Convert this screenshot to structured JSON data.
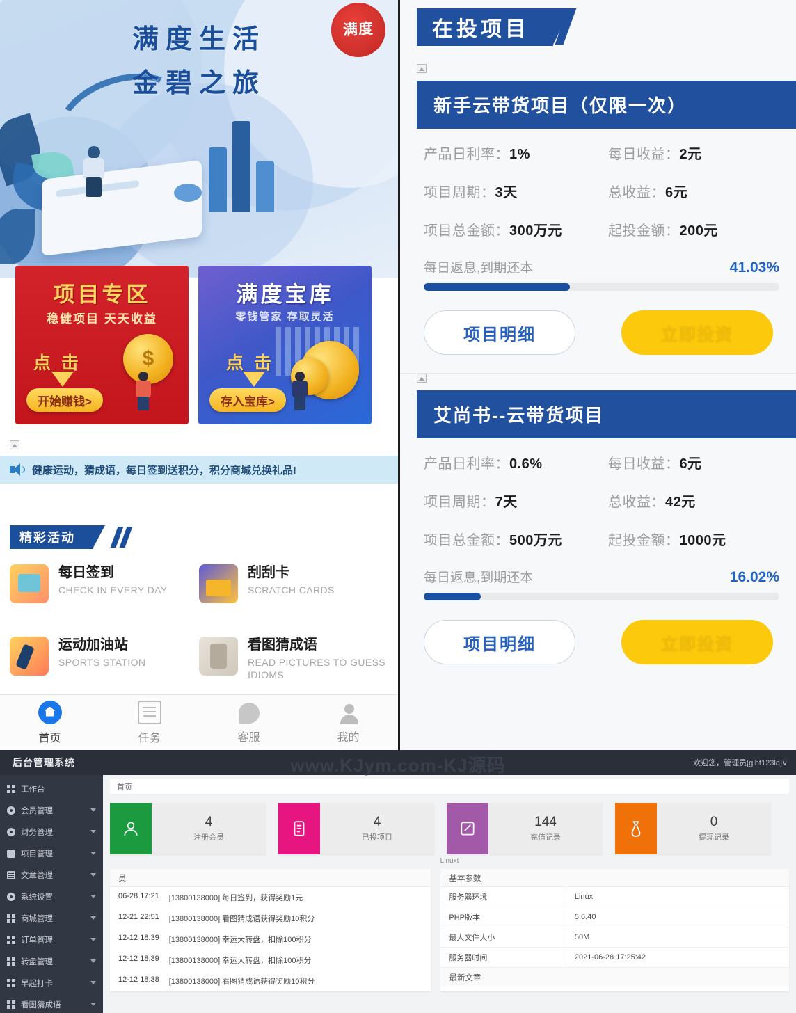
{
  "app_left": {
    "hero": {
      "line1": "满度生活",
      "line2": "金碧之旅",
      "stamp": "满度"
    },
    "promos": [
      {
        "title": "项目专区",
        "subtitle": "稳健项目  天天收益",
        "click": "点 击",
        "button": "开始赚钱>"
      },
      {
        "title": "满度宝库",
        "subtitle": "零钱管家  存取灵活",
        "click": "点 击",
        "button": "存入宝库>"
      }
    ],
    "notice": "健康运动，猜成语，每日签到送积分，积分商城兑换礼品!",
    "section_title": "精彩活动",
    "activities": [
      {
        "cn": "每日签到",
        "en": "CHECK IN EVERY DAY"
      },
      {
        "cn": "刮刮卡",
        "en": "SCRATCH CARDS"
      },
      {
        "cn": "运动加油站",
        "en": "SPORTS STATION"
      },
      {
        "cn": "看图猜成语",
        "en": "READ PICTURES TO GUESS IDIOMS"
      }
    ],
    "tabs": [
      {
        "label": "首页",
        "icon": "home-icon",
        "active": true
      },
      {
        "label": "任务",
        "icon": "task-icon",
        "active": false
      },
      {
        "label": "客服",
        "icon": "service-icon",
        "active": false
      },
      {
        "label": "我的",
        "icon": "person-icon",
        "active": false
      }
    ]
  },
  "app_right": {
    "header_title": "在投项目",
    "cards": [
      {
        "title": "新手云带货项目（仅限一次）",
        "rows": [
          {
            "k": "产品日利率：",
            "v": "1%"
          },
          {
            "k": "每日收益：",
            "v": "2元"
          },
          {
            "k": "项目周期：",
            "v": "3天"
          },
          {
            "k": "总收益：",
            "v": "6元"
          },
          {
            "k": "项目总金额：",
            "v": "300万元"
          },
          {
            "k": "起投金额：",
            "v": "200元"
          }
        ],
        "note": "每日返息,到期还本",
        "percent": "41.03%",
        "percent_value": 41.03,
        "btn_detail": "项目明细",
        "btn_invest": "立即投资"
      },
      {
        "title": "艾尚书--云带货项目",
        "rows": [
          {
            "k": "产品日利率：",
            "v": "0.6%"
          },
          {
            "k": "每日收益：",
            "v": "6元"
          },
          {
            "k": "项目周期：",
            "v": "7天"
          },
          {
            "k": "总收益：",
            "v": "42元"
          },
          {
            "k": "项目总金额：",
            "v": "500万元"
          },
          {
            "k": "起投金额：",
            "v": "1000元"
          }
        ],
        "note": "每日返息,到期还本",
        "percent": "16.02%",
        "percent_value": 16.02,
        "btn_detail": "项目明细",
        "btn_invest": "立即投资"
      }
    ]
  },
  "admin": {
    "brand": "后台管理系统",
    "watermark": "www.KJym.com-KJ源码",
    "user_greeting": "欢迎您，管理员[glht123lq]∨",
    "breadcrumb": "首页",
    "linux_label": "Linuxt",
    "sidebar": [
      {
        "label": "工作台",
        "icon": "grid-icon",
        "expandable": false
      },
      {
        "label": "会员管理",
        "icon": "shield-icon",
        "expandable": true
      },
      {
        "label": "财务管理",
        "icon": "coin-icon",
        "expandable": true
      },
      {
        "label": "项目管理",
        "icon": "book-icon",
        "expandable": true
      },
      {
        "label": "文章管理",
        "icon": "doc-icon",
        "expandable": true
      },
      {
        "label": "系统设置",
        "icon": "gear-icon",
        "expandable": true
      },
      {
        "label": "商城管理",
        "icon": "grid-icon",
        "expandable": true
      },
      {
        "label": "订单管理",
        "icon": "grid-icon",
        "expandable": true
      },
      {
        "label": "转盘管理",
        "icon": "grid-icon",
        "expandable": true
      },
      {
        "label": "早起打卡",
        "icon": "grid-icon",
        "expandable": true
      },
      {
        "label": "看图猜成语",
        "icon": "grid-icon",
        "expandable": true
      }
    ],
    "stats": [
      {
        "value": "4",
        "label": "注册会员",
        "color": "#1b9a3f",
        "icon": "user-icon"
      },
      {
        "value": "4",
        "label": "已投项目",
        "color": "#e6157f",
        "icon": "list-icon"
      },
      {
        "value": "144",
        "label": "充值记录",
        "color": "#a259a8",
        "icon": "edit-icon"
      },
      {
        "value": "0",
        "label": "提现记录",
        "color": "#ef7108",
        "icon": "bag-icon"
      }
    ],
    "log_panel_title": "员",
    "logs": [
      {
        "time": "06-28 17:21",
        "text": "[13800138000] 每日签到，获得奖励1元"
      },
      {
        "time": "12-21 22:51",
        "text": "[13800138000] 看图猜成语获得奖励10积分"
      },
      {
        "time": "12-12 18:39",
        "text": "[13800138000] 幸运大转盘，扣除100积分"
      },
      {
        "time": "12-12 18:39",
        "text": "[13800138000] 幸运大转盘，扣除100积分"
      },
      {
        "time": "12-12 18:38",
        "text": "[13800138000] 看图猜成语获得奖励10积分"
      }
    ],
    "params_title": "基本参数",
    "params": [
      {
        "k": "服务器环境",
        "v": "Linux"
      },
      {
        "k": "PHP版本",
        "v": "5.6.40"
      },
      {
        "k": "最大文件大小",
        "v": "50M"
      },
      {
        "k": "服务器时间",
        "v": "2021-06-28 17:25:42"
      }
    ],
    "articles_title": "最新文章"
  }
}
